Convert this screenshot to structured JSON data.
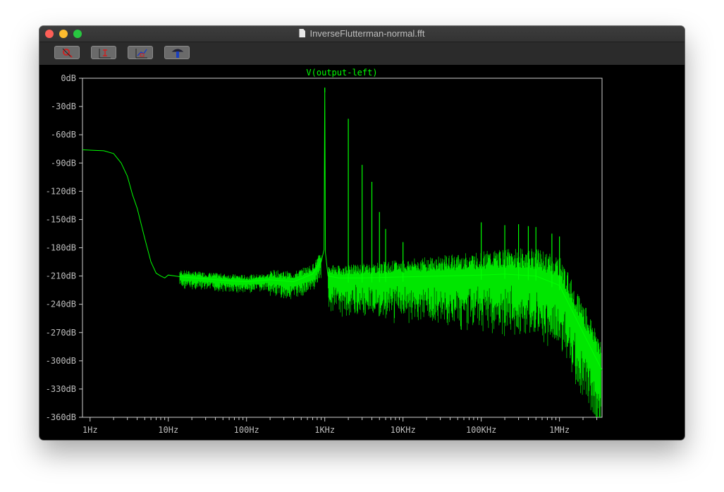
{
  "window": {
    "title": "InverseFlutterman-normal.fft"
  },
  "toolbar": {
    "buttons": [
      {
        "name": "zoom-cancel-icon"
      },
      {
        "name": "autorange-icon"
      },
      {
        "name": "zoom-extents-icon"
      },
      {
        "name": "probe-icon"
      }
    ]
  },
  "colors": {
    "trace": "#00ff00",
    "axis": "#cccccc",
    "background": "#000000"
  },
  "chart_data": {
    "type": "line",
    "title": "V(output-left)",
    "xscale": "log",
    "xlim": [
      0.8,
      3500000
    ],
    "ylim": [
      -360,
      0
    ],
    "x_ticks": [
      {
        "value": 1,
        "label": "1Hz"
      },
      {
        "value": 10,
        "label": "10Hz"
      },
      {
        "value": 100,
        "label": "100Hz"
      },
      {
        "value": 1000,
        "label": "1KHz"
      },
      {
        "value": 10000,
        "label": "10KHz"
      },
      {
        "value": 100000,
        "label": "100KHz"
      },
      {
        "value": 1000000,
        "label": "1MHz"
      }
    ],
    "y_ticks": [
      {
        "value": 0,
        "label": "0dB"
      },
      {
        "value": -30,
        "label": "-30dB"
      },
      {
        "value": -60,
        "label": "-60dB"
      },
      {
        "value": -90,
        "label": "-90dB"
      },
      {
        "value": -120,
        "label": "-120dB"
      },
      {
        "value": -150,
        "label": "-150dB"
      },
      {
        "value": -180,
        "label": "-180dB"
      },
      {
        "value": -210,
        "label": "-210dB"
      },
      {
        "value": -240,
        "label": "-240dB"
      },
      {
        "value": -270,
        "label": "-270dB"
      },
      {
        "value": -300,
        "label": "-300dB"
      },
      {
        "value": -330,
        "label": "-330dB"
      },
      {
        "value": -360,
        "label": "-360dB"
      }
    ],
    "series": [
      {
        "name": "V(output-left)",
        "x": [
          0.8,
          1.5,
          2,
          2.5,
          3,
          3.5,
          4,
          5,
          6,
          7,
          8,
          9,
          10,
          15,
          30,
          60,
          100,
          200,
          400,
          700,
          900,
          980,
          1000,
          1020,
          1100,
          1500,
          3000,
          10000,
          30000,
          100000,
          200000,
          500000,
          1000000,
          2000000,
          3500000
        ],
        "y": [
          -76,
          -77,
          -80,
          -90,
          -104,
          -124,
          -138,
          -170,
          -195,
          -207,
          -210,
          -212,
          -209,
          -211,
          -213,
          -215,
          -216,
          -214,
          -216,
          -208,
          -195,
          -182,
          -10,
          -185,
          -210,
          -212,
          -212,
          -211,
          -210,
          -209,
          -208,
          -210,
          -220,
          -270,
          -310
        ]
      }
    ],
    "peaks": [
      {
        "x": 1000,
        "y": -10
      },
      {
        "x": 2000,
        "y": -43
      },
      {
        "x": 3000,
        "y": -92
      },
      {
        "x": 4000,
        "y": -110
      },
      {
        "x": 5000,
        "y": -142
      },
      {
        "x": 6000,
        "y": -160
      },
      {
        "x": 10000,
        "y": -174
      },
      {
        "x": 100000,
        "y": -153
      },
      {
        "x": 200000,
        "y": -156
      },
      {
        "x": 300000,
        "y": -155
      },
      {
        "x": 400000,
        "y": -157
      },
      {
        "x": 500000,
        "y": -158
      },
      {
        "x": 800000,
        "y": -165
      },
      {
        "x": 1000000,
        "y": -168
      }
    ]
  }
}
